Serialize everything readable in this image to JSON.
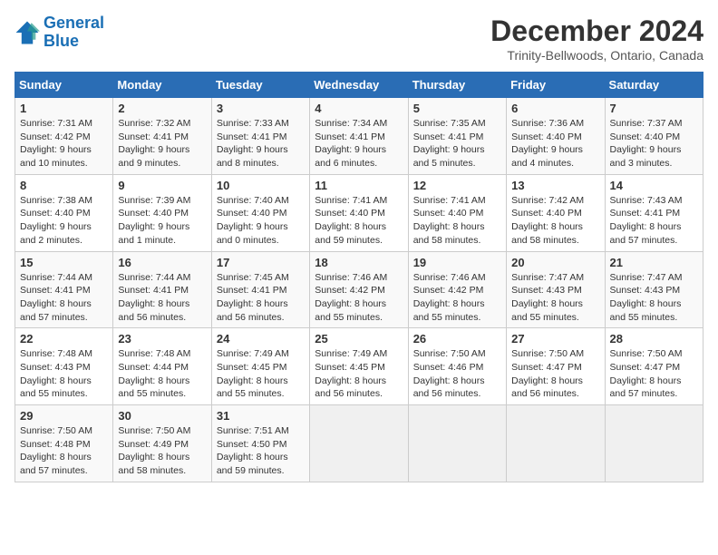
{
  "header": {
    "logo_line1": "General",
    "logo_line2": "Blue",
    "month_title": "December 2024",
    "subtitle": "Trinity-Bellwoods, Ontario, Canada"
  },
  "days_of_week": [
    "Sunday",
    "Monday",
    "Tuesday",
    "Wednesday",
    "Thursday",
    "Friday",
    "Saturday"
  ],
  "weeks": [
    [
      {
        "day": 1,
        "sunrise": "7:31 AM",
        "sunset": "4:42 PM",
        "daylight": "9 hours and 10 minutes."
      },
      {
        "day": 2,
        "sunrise": "7:32 AM",
        "sunset": "4:41 PM",
        "daylight": "9 hours and 9 minutes."
      },
      {
        "day": 3,
        "sunrise": "7:33 AM",
        "sunset": "4:41 PM",
        "daylight": "9 hours and 8 minutes."
      },
      {
        "day": 4,
        "sunrise": "7:34 AM",
        "sunset": "4:41 PM",
        "daylight": "9 hours and 6 minutes."
      },
      {
        "day": 5,
        "sunrise": "7:35 AM",
        "sunset": "4:41 PM",
        "daylight": "9 hours and 5 minutes."
      },
      {
        "day": 6,
        "sunrise": "7:36 AM",
        "sunset": "4:40 PM",
        "daylight": "9 hours and 4 minutes."
      },
      {
        "day": 7,
        "sunrise": "7:37 AM",
        "sunset": "4:40 PM",
        "daylight": "9 hours and 3 minutes."
      }
    ],
    [
      {
        "day": 8,
        "sunrise": "7:38 AM",
        "sunset": "4:40 PM",
        "daylight": "9 hours and 2 minutes."
      },
      {
        "day": 9,
        "sunrise": "7:39 AM",
        "sunset": "4:40 PM",
        "daylight": "9 hours and 1 minute."
      },
      {
        "day": 10,
        "sunrise": "7:40 AM",
        "sunset": "4:40 PM",
        "daylight": "9 hours and 0 minutes."
      },
      {
        "day": 11,
        "sunrise": "7:41 AM",
        "sunset": "4:40 PM",
        "daylight": "8 hours and 59 minutes."
      },
      {
        "day": 12,
        "sunrise": "7:41 AM",
        "sunset": "4:40 PM",
        "daylight": "8 hours and 58 minutes."
      },
      {
        "day": 13,
        "sunrise": "7:42 AM",
        "sunset": "4:40 PM",
        "daylight": "8 hours and 58 minutes."
      },
      {
        "day": 14,
        "sunrise": "7:43 AM",
        "sunset": "4:41 PM",
        "daylight": "8 hours and 57 minutes."
      }
    ],
    [
      {
        "day": 15,
        "sunrise": "7:44 AM",
        "sunset": "4:41 PM",
        "daylight": "8 hours and 57 minutes."
      },
      {
        "day": 16,
        "sunrise": "7:44 AM",
        "sunset": "4:41 PM",
        "daylight": "8 hours and 56 minutes."
      },
      {
        "day": 17,
        "sunrise": "7:45 AM",
        "sunset": "4:41 PM",
        "daylight": "8 hours and 56 minutes."
      },
      {
        "day": 18,
        "sunrise": "7:46 AM",
        "sunset": "4:42 PM",
        "daylight": "8 hours and 55 minutes."
      },
      {
        "day": 19,
        "sunrise": "7:46 AM",
        "sunset": "4:42 PM",
        "daylight": "8 hours and 55 minutes."
      },
      {
        "day": 20,
        "sunrise": "7:47 AM",
        "sunset": "4:43 PM",
        "daylight": "8 hours and 55 minutes."
      },
      {
        "day": 21,
        "sunrise": "7:47 AM",
        "sunset": "4:43 PM",
        "daylight": "8 hours and 55 minutes."
      }
    ],
    [
      {
        "day": 22,
        "sunrise": "7:48 AM",
        "sunset": "4:43 PM",
        "daylight": "8 hours and 55 minutes."
      },
      {
        "day": 23,
        "sunrise": "7:48 AM",
        "sunset": "4:44 PM",
        "daylight": "8 hours and 55 minutes."
      },
      {
        "day": 24,
        "sunrise": "7:49 AM",
        "sunset": "4:45 PM",
        "daylight": "8 hours and 55 minutes."
      },
      {
        "day": 25,
        "sunrise": "7:49 AM",
        "sunset": "4:45 PM",
        "daylight": "8 hours and 56 minutes."
      },
      {
        "day": 26,
        "sunrise": "7:50 AM",
        "sunset": "4:46 PM",
        "daylight": "8 hours and 56 minutes."
      },
      {
        "day": 27,
        "sunrise": "7:50 AM",
        "sunset": "4:47 PM",
        "daylight": "8 hours and 56 minutes."
      },
      {
        "day": 28,
        "sunrise": "7:50 AM",
        "sunset": "4:47 PM",
        "daylight": "8 hours and 57 minutes."
      }
    ],
    [
      {
        "day": 29,
        "sunrise": "7:50 AM",
        "sunset": "4:48 PM",
        "daylight": "8 hours and 57 minutes."
      },
      {
        "day": 30,
        "sunrise": "7:50 AM",
        "sunset": "4:49 PM",
        "daylight": "8 hours and 58 minutes."
      },
      {
        "day": 31,
        "sunrise": "7:51 AM",
        "sunset": "4:50 PM",
        "daylight": "8 hours and 59 minutes."
      },
      null,
      null,
      null,
      null
    ]
  ]
}
